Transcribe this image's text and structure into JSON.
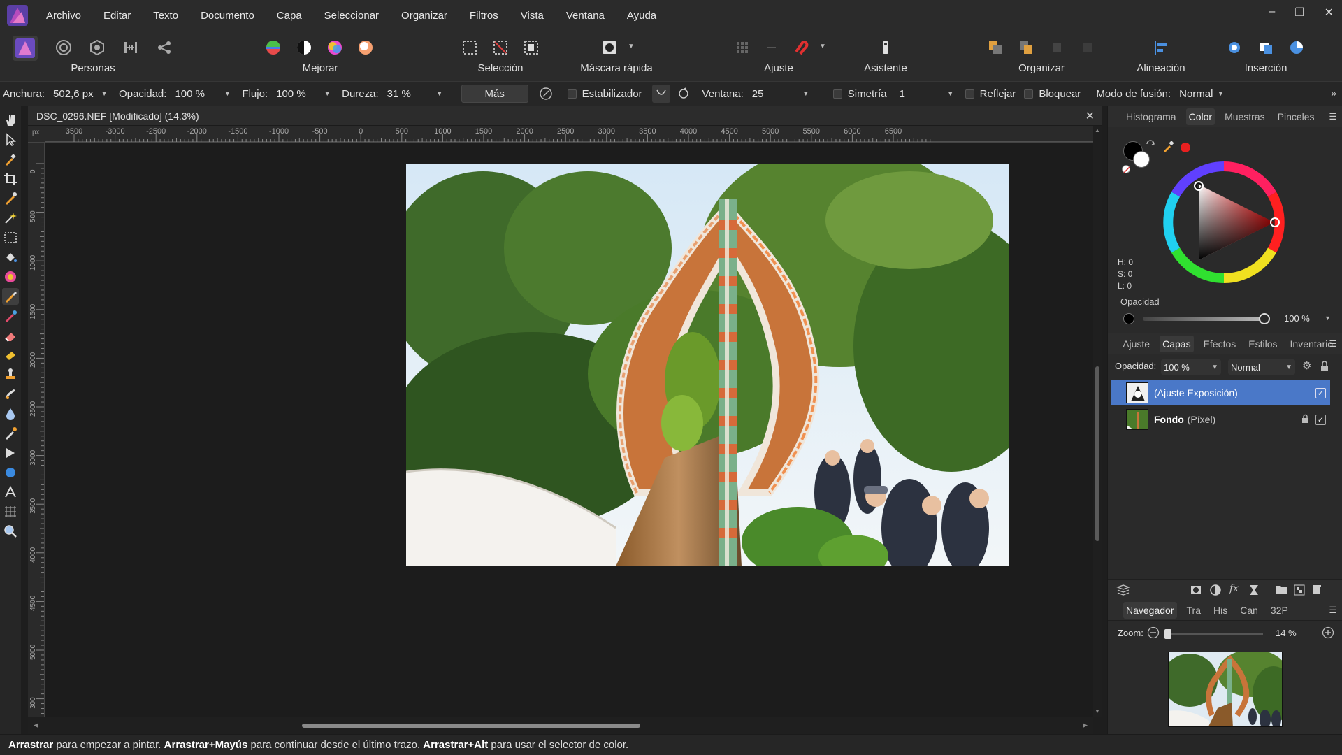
{
  "menu": [
    "Archivo",
    "Editar",
    "Texto",
    "Documento",
    "Capa",
    "Seleccionar",
    "Organizar",
    "Filtros",
    "Vista",
    "Ventana",
    "Ayuda"
  ],
  "window_controls": [
    "–",
    "❐",
    "✕"
  ],
  "toolbar": {
    "personas_label": "Personas",
    "mejorar_label": "Mejorar",
    "seleccion_label": "Selección",
    "mascara_label": "Máscara rápida",
    "ajuste_label": "Ajuste",
    "asistente_label": "Asistente",
    "organizar_label": "Organizar",
    "alineacion_label": "Alineación",
    "insercion_label": "Inserción"
  },
  "context": {
    "anchura_label": "Anchura:",
    "anchura_value": "502,6 px",
    "opacidad_label": "Opacidad:",
    "opacidad_value": "100 %",
    "flujo_label": "Flujo:",
    "flujo_value": "100 %",
    "dureza_label": "Dureza:",
    "dureza_value": "31 %",
    "mas_label": "Más",
    "estabilizador_label": "Estabilizador",
    "ventana_label": "Ventana:",
    "ventana_value": "25",
    "simetria_label": "Simetría",
    "simetria_value": "1",
    "reflejar_label": "Reflejar",
    "bloquear_label": "Bloquear",
    "modo_label": "Modo de fusión:",
    "modo_value": "Normal"
  },
  "document": {
    "title": "DSC_0296.NEF [Modificado] (14.3%)",
    "ruler_unit": "px",
    "ruler_top_labels": [
      "3500",
      "-3000",
      "-2500",
      "-2000",
      "-1500",
      "-1000",
      "-500",
      "0",
      "500",
      "1000",
      "1500",
      "2000",
      "2500",
      "3000",
      "3500",
      "4000",
      "4500",
      "5000",
      "5500",
      "6000",
      "6500"
    ],
    "ruler_left_labels": [
      "0",
      "500",
      "1000",
      "1500",
      "2000",
      "2500",
      "3000",
      "3500",
      "4000",
      "4500",
      "5000",
      "300"
    ]
  },
  "color_panel": {
    "tabs": [
      "Histograma",
      "Color",
      "Muestras",
      "Pinceles"
    ],
    "active_tab": "Color",
    "h": "H: 0",
    "s": "S: 0",
    "l": "L: 0",
    "opacity_label": "Opacidad",
    "opacity_value": "100 %",
    "opacity_fraction": 1.0,
    "primary_color": "#000000",
    "secondary_color": "#ffffff",
    "hue_color": "#ff0000"
  },
  "layers_panel": {
    "tabs": [
      "Ajuste",
      "Capas",
      "Efectos",
      "Estilos",
      "Inventario"
    ],
    "active_tab": "Capas",
    "opacity_label": "Opacidad:",
    "opacity_value": "100 %",
    "blend_value": "Normal",
    "layers": [
      {
        "name": "(Ajuste Exposición)",
        "type": "",
        "selected": true,
        "locked": false,
        "visible": true
      },
      {
        "name": "Fondo",
        "type": "(Píxel)",
        "selected": false,
        "locked": true,
        "visible": true
      }
    ]
  },
  "navigator": {
    "tabs": [
      "Navegador",
      "Tra",
      "His",
      "Can",
      "32P"
    ],
    "active_tab": "Navegador",
    "zoom_label": "Zoom:",
    "zoom_value": "14 %",
    "zoom_fraction": 0.03
  },
  "status": {
    "b1": "Arrastrar",
    "t1": " para empezar a pintar. ",
    "b2": "Arrastrar+Mayús",
    "t2": " para continuar desde el último trazo. ",
    "b3": "Arrastrar+Alt",
    "t3": " para usar el selector de color."
  },
  "colors": {
    "accent": "#4a78c8",
    "selection_row": "#4a78c8"
  }
}
